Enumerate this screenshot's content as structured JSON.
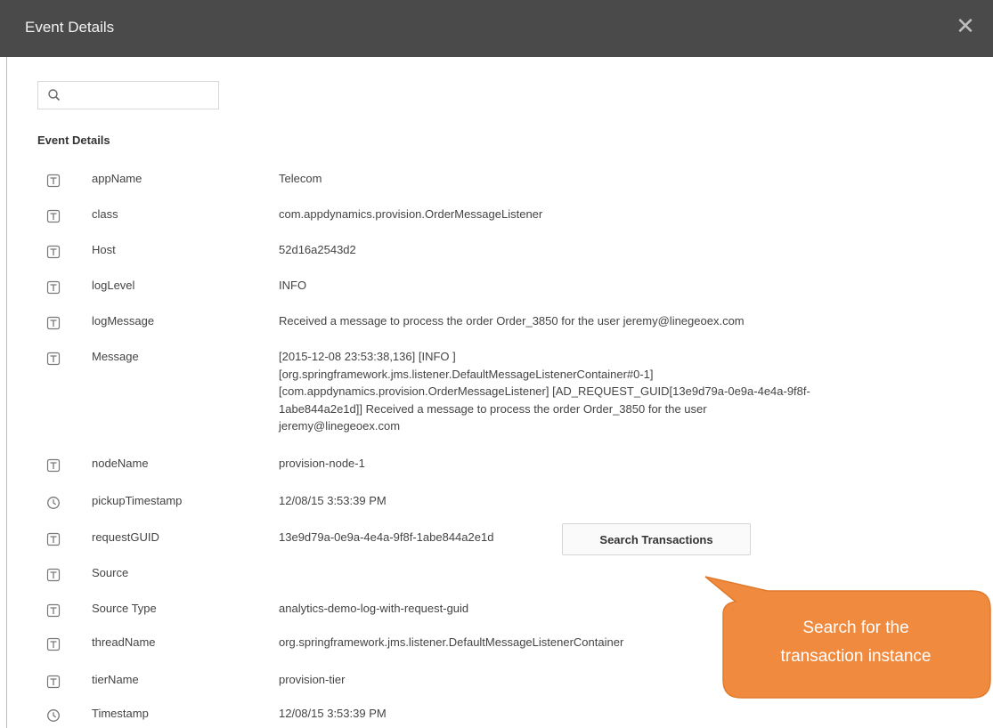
{
  "dialog": {
    "title": "Event Details"
  },
  "search": {
    "value": "",
    "placeholder": ""
  },
  "section": {
    "heading": "Event Details"
  },
  "fields": [
    {
      "icon": "text-field-icon",
      "name": "appName",
      "value": "Telecom"
    },
    {
      "icon": "text-field-icon",
      "name": "class",
      "value": "com.appdynamics.provision.OrderMessageListener"
    },
    {
      "icon": "text-field-icon",
      "name": "Host",
      "value": "52d16a2543d2"
    },
    {
      "icon": "text-field-icon",
      "name": "logLevel",
      "value": "INFO"
    },
    {
      "icon": "text-field-icon",
      "name": "logMessage",
      "value": "Received a message to process the order Order_3850 for the user jeremy@linegeoex.com"
    },
    {
      "icon": "text-field-icon",
      "name": "Message",
      "value_lines": [
        "[2015-12-08 23:53:38,136]  [INFO ]",
        "[org.springframework.jms.listener.DefaultMessageListenerContainer#0-1]",
        "[com.appdynamics.provision.OrderMessageListener]  [AD_REQUEST_GUID[13e9d79a-0e9a-4e4a-9f8f-",
        "1abe844a2e1d]]  Received a message to process the order Order_3850 for the user",
        "jeremy@linegeoex.com"
      ]
    },
    {
      "icon": "text-field-icon",
      "name": "nodeName",
      "value": "provision-node-1"
    },
    {
      "icon": "clock-icon",
      "name": "pickupTimestamp",
      "value": "12/08/15 3:53:39 PM"
    },
    {
      "icon": "text-field-icon",
      "name": "requestGUID",
      "value": "13e9d79a-0e9a-4e4a-9f8f-1abe844a2e1d"
    },
    {
      "icon": "text-field-icon",
      "name": "Source",
      "value": ""
    },
    {
      "icon": "text-field-icon",
      "name": "Source Type",
      "value": "analytics-demo-log-with-request-guid"
    },
    {
      "icon": "text-field-icon",
      "name": "threadName",
      "value": "org.springframework.jms.listener.DefaultMessageListenerContainer"
    },
    {
      "icon": "text-field-icon",
      "name": "tierName",
      "value": "provision-tier"
    },
    {
      "icon": "clock-icon",
      "name": "Timestamp",
      "value": "12/08/15 3:53:39 PM"
    }
  ],
  "actions": {
    "search_transactions": "Search Transactions"
  },
  "callout": {
    "line1": "Search for the",
    "line2": "transaction instance"
  },
  "colors": {
    "titlebar": "#4a4a4a",
    "callout": "#f08a3e",
    "callout_border": "#e07a2c"
  }
}
